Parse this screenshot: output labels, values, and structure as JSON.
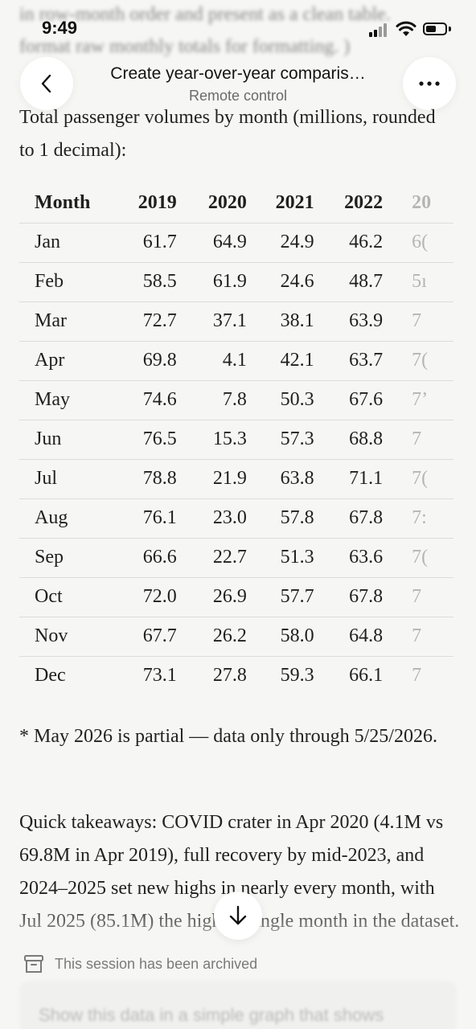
{
  "status_bar": {
    "time": "9:49"
  },
  "background_text": {
    "line1": "in row-month order and present as a clean table.",
    "line2": "format raw monthly totals for formatting. )"
  },
  "header": {
    "title": "Create year-over-year comparis…",
    "subtitle": "Remote control",
    "back_icon": "chevron-left-icon",
    "more_icon": "ellipsis-icon"
  },
  "intro": "Total passenger volumes by month (millions, rounded to 1 decimal):",
  "table": {
    "headers": [
      "Month",
      "2019",
      "2020",
      "2021",
      "2022",
      "20"
    ],
    "rows": [
      [
        "Jan",
        "61.7",
        "64.9",
        "24.9",
        "46.2",
        "6("
      ],
      [
        "Feb",
        "58.5",
        "61.9",
        "24.6",
        "48.7",
        "5ı"
      ],
      [
        "Mar",
        "72.7",
        "37.1",
        "38.1",
        "63.9",
        "7"
      ],
      [
        "Apr",
        "69.8",
        "4.1",
        "42.1",
        "63.7",
        "7("
      ],
      [
        "May",
        "74.6",
        "7.8",
        "50.3",
        "67.6",
        "7’"
      ],
      [
        "Jun",
        "76.5",
        "15.3",
        "57.3",
        "68.8",
        "7"
      ],
      [
        "Jul",
        "78.8",
        "21.9",
        "63.8",
        "71.1",
        "7("
      ],
      [
        "Aug",
        "76.1",
        "23.0",
        "57.8",
        "67.8",
        "7:"
      ],
      [
        "Sep",
        "66.6",
        "22.7",
        "51.3",
        "63.6",
        "7("
      ],
      [
        "Oct",
        "72.0",
        "26.9",
        "57.7",
        "67.8",
        "7"
      ],
      [
        "Nov",
        "67.7",
        "26.2",
        "58.0",
        "64.8",
        "7"
      ],
      [
        "Dec",
        "73.1",
        "27.8",
        "59.3",
        "66.1",
        "7"
      ]
    ]
  },
  "note": "* May 2026 is partial — data only through 5/25/2026.",
  "takeaways": "Quick takeaways: COVID crater in Apr 2020 (4.1M vs 69.8M in Apr 2019), full recovery by mid-2023, and 2024–2025 set new highs in nearly every month, with Jul 2025 (85.1M) the highest single month in the dataset.",
  "archived": {
    "icon": "archive-box-icon",
    "text": "This session has been archived"
  },
  "next_message": "Show this data in a simple graph that shows",
  "scroll_button": {
    "icon": "arrow-down-icon"
  }
}
